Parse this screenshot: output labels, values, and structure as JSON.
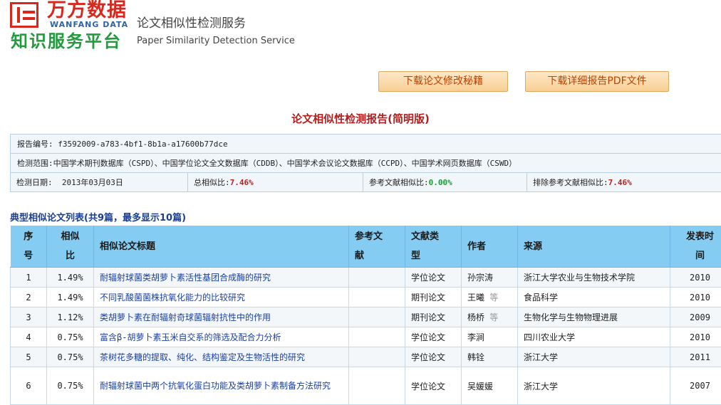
{
  "brand": {
    "logo_cn": "万方数据",
    "logo_en": "WANFANG DATA",
    "platform_cn": "知识服务平台",
    "service_cn": "论文相似性检测服务",
    "service_en": "Paper Similarity Detection Service"
  },
  "buttons": {
    "download_guide": "下载论文修改秘籍",
    "download_pdf": "下载详细报告PDF文件"
  },
  "report": {
    "title": "论文相似性检测报告(简明版)",
    "id_label": "报告编号:",
    "id_value": "f3592009-a783-4bf1-8b1a-a17600b77dce",
    "scope_label": "检测范围:",
    "scope_value": "中国学术期刊数据库（CSPD）、中国学位论文全文数据库（CDDB）、中国学术会议论文数据库（CCPD）、中国学术网页数据库（CSWD）",
    "date_label": "检测日期:",
    "date_value": "2013年03月03日",
    "total_label": "总相似比:",
    "total_value": "7.46%",
    "ref_label": "参考文献相似比:",
    "ref_value": "0.00%",
    "excl_label": "排除参考文献相似比:",
    "excl_value": "7.46%"
  },
  "list": {
    "title": "典型相似论文列表(共9篇，最多显示10篇)",
    "headers": {
      "no_1": "序",
      "no_2": "号",
      "ratio_1": "相似",
      "ratio_2": "比",
      "title": "相似论文标题",
      "ref_1": "参考文",
      "ref_2": "献",
      "type_1": "文献类",
      "type_2": "型",
      "author": "作者",
      "source": "来源",
      "year_1": "发表时",
      "year_2": "间"
    },
    "rows": [
      {
        "no": "1",
        "ratio": "1.49%",
        "title": "耐辐射球菌类胡萝卜素活性基团合成酶的研究",
        "ref": "",
        "type": "学位论文",
        "author": "孙宗涛",
        "etal": "",
        "source": "浙江大学农业与生物技术学院",
        "year": "2010"
      },
      {
        "no": "2",
        "ratio": "1.49%",
        "title": "不同乳酸菌菌株抗氧化能力的比较研究",
        "ref": "",
        "type": "期刊论文",
        "author": "王曦",
        "etal": "等",
        "source": "食品科学",
        "year": "2010"
      },
      {
        "no": "3",
        "ratio": "1.12%",
        "title": "类胡萝卜素在耐辐射奇球菌辐射抗性中的作用",
        "ref": "",
        "type": "期刊论文",
        "author": "杨桥",
        "etal": "等",
        "source": "生物化学与生物物理进展",
        "year": "2009"
      },
      {
        "no": "4",
        "ratio": "0.75%",
        "title": "富含β-胡萝卜素玉米自交系的筛选及配合力分析",
        "ref": "",
        "type": "学位论文",
        "author": "李涧",
        "etal": "",
        "source": "四川农业大学",
        "year": "2010"
      },
      {
        "no": "5",
        "ratio": "0.75%",
        "title": "茶树花多糖的提取、纯化、结构鉴定及生物活性的研究",
        "ref": "",
        "type": "学位论文",
        "author": "韩铨",
        "etal": "",
        "source": "浙江大学",
        "year": "2011"
      },
      {
        "no": "6",
        "ratio": "0.75%",
        "title": "耐辐射球菌中两个抗氧化蛋白功能及类胡萝卜素制备方法研究",
        "ref": "",
        "type": "学位论文",
        "author": "吴媛媛",
        "etal": "",
        "source": "浙江大学",
        "year": "2007"
      }
    ]
  }
}
